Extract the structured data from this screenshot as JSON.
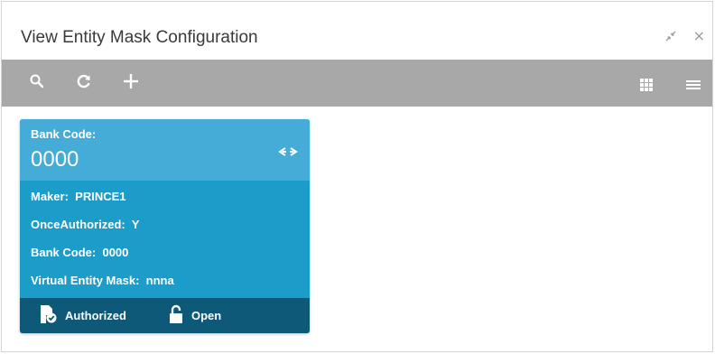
{
  "window": {
    "title": "View Entity Mask Configuration",
    "controls": {
      "minimize_icon": "minimize-icon",
      "close_icon": "close-icon",
      "close_glyph": "×"
    }
  },
  "toolbar": {
    "left": [
      {
        "name": "search-icon"
      },
      {
        "name": "refresh-icon"
      },
      {
        "name": "add-icon"
      }
    ],
    "right": [
      {
        "name": "grid-view-icon"
      },
      {
        "name": "list-view-icon"
      }
    ],
    "background": "#a8a8a8"
  },
  "card": {
    "header_label": "Bank Code:",
    "header_value": "0000",
    "fields": [
      {
        "label": "Maker:",
        "value": "PRINCE1"
      },
      {
        "label": "OnceAuthorized:",
        "value": "Y"
      },
      {
        "label": "Bank Code:",
        "value": "0000"
      },
      {
        "label": "Virtual Entity Mask:",
        "value": "nnna"
      }
    ],
    "footer": {
      "auth_status": "Authorized",
      "lock_status": "Open"
    },
    "colors": {
      "header": "#45acd7",
      "body": "#1c9cc9",
      "footer": "#0d5977"
    }
  }
}
